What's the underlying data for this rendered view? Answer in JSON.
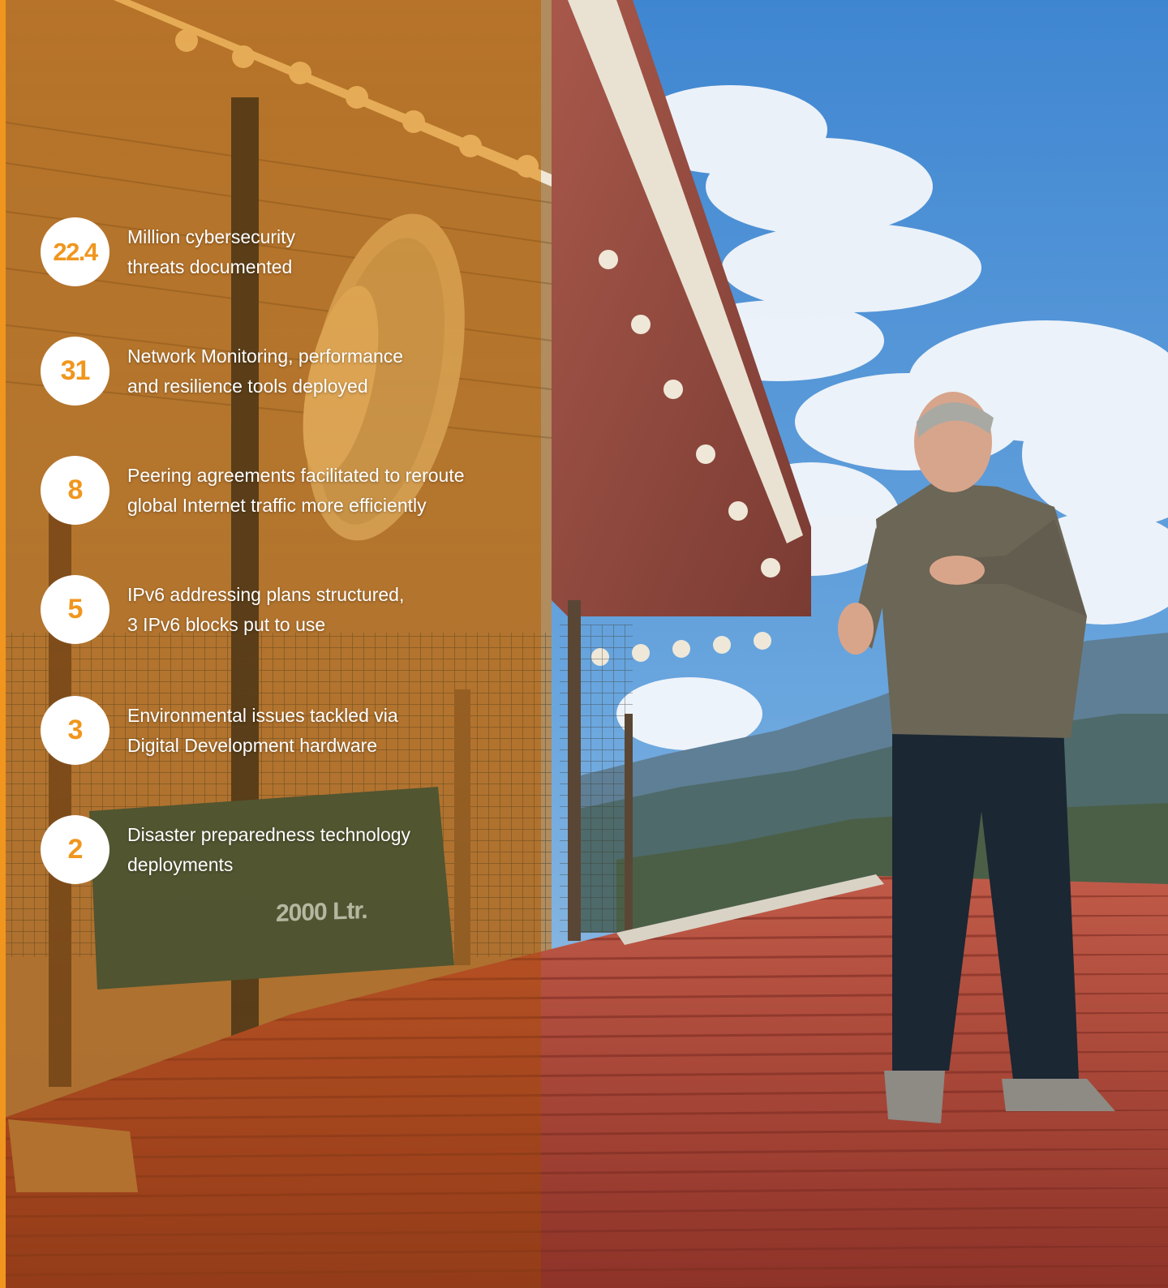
{
  "colors": {
    "accent": "#f0961e",
    "circle_bg": "#ffffff",
    "text": "#ffffff",
    "sky": "#4f93d6",
    "roof": "#b24a3a"
  },
  "stats": [
    {
      "value": "22.4",
      "lines": [
        "Million cybersecurity",
        "threats documented"
      ]
    },
    {
      "value": "31",
      "lines": [
        "Network Monitoring, performance",
        "and resilience tools deployed"
      ]
    },
    {
      "value": "8",
      "lines": [
        "Peering agreements facilitated to reroute",
        "global Internet traffic more efficiently"
      ]
    },
    {
      "value": "5",
      "lines": [
        "IPv6 addressing plans structured,",
        "3 IPv6 blocks put to use"
      ]
    },
    {
      "value": "3",
      "lines": [
        "Environmental issues tackled via",
        "Digital Development hardware"
      ]
    },
    {
      "value": "2",
      "lines": [
        "Disaster preparedness technology",
        "deployments"
      ]
    }
  ],
  "photo": {
    "tank_label": "2000 Ltr."
  }
}
